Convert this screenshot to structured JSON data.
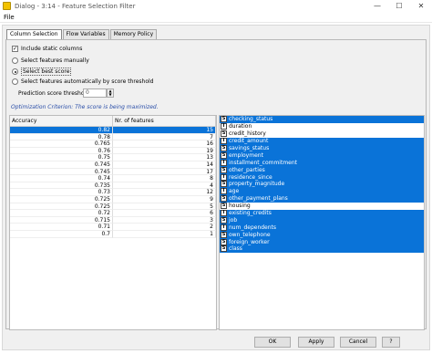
{
  "window": {
    "title": "Dialog - 3:14 - Feature Selection Filter",
    "minimize_glyph": "—",
    "maximize_glyph": "☐",
    "close_glyph": "✕"
  },
  "menu": {
    "file": "File"
  },
  "tabs": [
    {
      "label": "Column Selection"
    },
    {
      "label": "Flow Variables"
    },
    {
      "label": "Memory Policy"
    }
  ],
  "options": {
    "include_static": "Include static columns",
    "include_static_checked": true,
    "select_manually": "Select features manually",
    "select_best": "Select best score",
    "select_auto": "Select features automatically by score threshold",
    "selected_option": "select_best"
  },
  "threshold": {
    "label": "Prediction score threshold",
    "value": "0"
  },
  "criterion_text": "Optimization Criterion: The score is being maximized.",
  "table": {
    "headers": [
      "Accuracy",
      "Nr. of features"
    ],
    "rows": [
      [
        "0.82",
        "15"
      ],
      [
        "0.78",
        "7"
      ],
      [
        "0.765",
        "16"
      ],
      [
        "0.76",
        "19"
      ],
      [
        "0.75",
        "13"
      ],
      [
        "0.745",
        "14"
      ],
      [
        "0.745",
        "17"
      ],
      [
        "0.74",
        "8"
      ],
      [
        "0.735",
        "4"
      ],
      [
        "0.73",
        "12"
      ],
      [
        "0.725",
        "9"
      ],
      [
        "0.725",
        "5"
      ],
      [
        "0.72",
        "6"
      ],
      [
        "0.715",
        "3"
      ],
      [
        "0.71",
        "2"
      ],
      [
        "0.7",
        "1"
      ]
    ],
    "selected_row": 0
  },
  "features": [
    {
      "type": "S",
      "name": "checking_status",
      "selected": true
    },
    {
      "type": "I",
      "name": "duration",
      "selected": false
    },
    {
      "type": "S",
      "name": "credit_history",
      "selected": false
    },
    {
      "type": "I",
      "name": "credit_amount",
      "selected": true
    },
    {
      "type": "S",
      "name": "savings_status",
      "selected": true
    },
    {
      "type": "S",
      "name": "employment",
      "selected": true
    },
    {
      "type": "I",
      "name": "installment_commitment",
      "selected": true
    },
    {
      "type": "S",
      "name": "other_parties",
      "selected": true
    },
    {
      "type": "I",
      "name": "residence_since",
      "selected": true
    },
    {
      "type": "S",
      "name": "property_magnitude",
      "selected": true
    },
    {
      "type": "I",
      "name": "age",
      "selected": true
    },
    {
      "type": "S",
      "name": "other_payment_plans",
      "selected": true
    },
    {
      "type": "S",
      "name": "housing",
      "selected": false
    },
    {
      "type": "I",
      "name": "existing_credits",
      "selected": true
    },
    {
      "type": "S",
      "name": "job",
      "selected": true
    },
    {
      "type": "I",
      "name": "num_dependents",
      "selected": true
    },
    {
      "type": "S",
      "name": "own_telephone",
      "selected": true
    },
    {
      "type": "S",
      "name": "foreign_worker",
      "selected": true
    },
    {
      "type": "S",
      "name": "class",
      "selected": true
    }
  ],
  "buttons": {
    "ok": "OK",
    "apply": "Apply",
    "cancel": "Cancel",
    "help": "?"
  },
  "colors": {
    "selection": "#0a73d8",
    "criterion": "#2a4ea8"
  }
}
